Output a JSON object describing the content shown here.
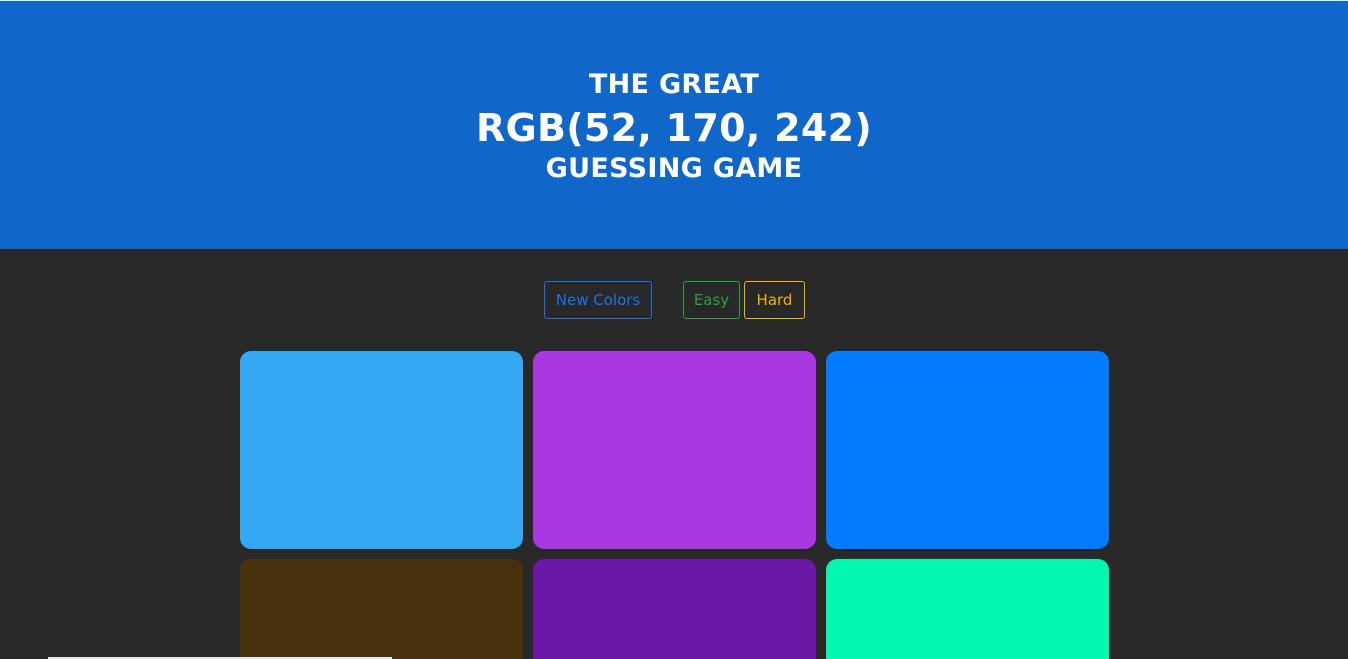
{
  "header": {
    "title_top": "THE GREAT",
    "rgb_display": "RGB(52, 170, 242)",
    "title_bottom": "GUESSING GAME",
    "background_color": "#1167c9"
  },
  "controls": {
    "new_colors_label": "New Colors",
    "new_colors_color": "#1a73e8",
    "easy_label": "Easy",
    "easy_color": "#2e9e40",
    "hard_label": "Hard",
    "hard_color": "#f0b400"
  },
  "squares": [
    {
      "color": "#34a8f2"
    },
    {
      "color": "#a838e0"
    },
    {
      "color": "#037cfd"
    },
    {
      "color": "#48320c"
    },
    {
      "color": "#6818a4"
    },
    {
      "color": "#02f7b0"
    }
  ]
}
